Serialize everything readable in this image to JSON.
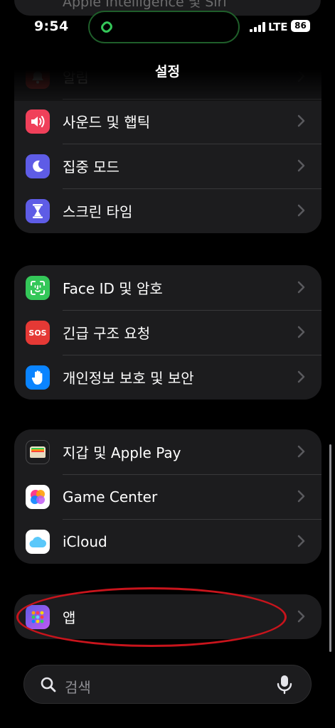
{
  "status_bar": {
    "time": "9:54",
    "network": "LTE",
    "battery": "86"
  },
  "partial_top_row": "Apple Intelligence 및 Siri",
  "nav": {
    "title": "설정"
  },
  "group1": [
    {
      "label": "알림",
      "icon": "bell-icon",
      "color": "#e53935"
    },
    {
      "label": "사운드 및 햅틱",
      "icon": "speaker-icon",
      "color": "#f0405a"
    },
    {
      "label": "집중 모드",
      "icon": "moon-icon",
      "color": "#5e5ce6"
    },
    {
      "label": "스크린 타임",
      "icon": "hourglass-icon",
      "color": "#5e5ce6"
    }
  ],
  "group2": [
    {
      "label": "Face ID 및 암호",
      "icon": "face-id-icon",
      "color": "#34c759"
    },
    {
      "label": "긴급 구조 요청",
      "icon": "sos-icon",
      "icon_text": "SOS",
      "color": "#e53935"
    },
    {
      "label": "개인정보 보호 및 보안",
      "icon": "hand-icon",
      "color": "#0a84ff"
    }
  ],
  "group3": [
    {
      "label": "지갑 및 Apple Pay",
      "icon": "wallet-icon",
      "color": "#1c1c1e"
    },
    {
      "label": "Game Center",
      "icon": "game-center-icon",
      "color": "#ffffff"
    },
    {
      "label": "iCloud",
      "icon": "cloud-icon",
      "color": "#ffffff"
    }
  ],
  "group4": [
    {
      "label": "앱",
      "icon": "apps-grid-icon",
      "color": "#5856d6"
    }
  ],
  "search": {
    "placeholder": "검색"
  }
}
